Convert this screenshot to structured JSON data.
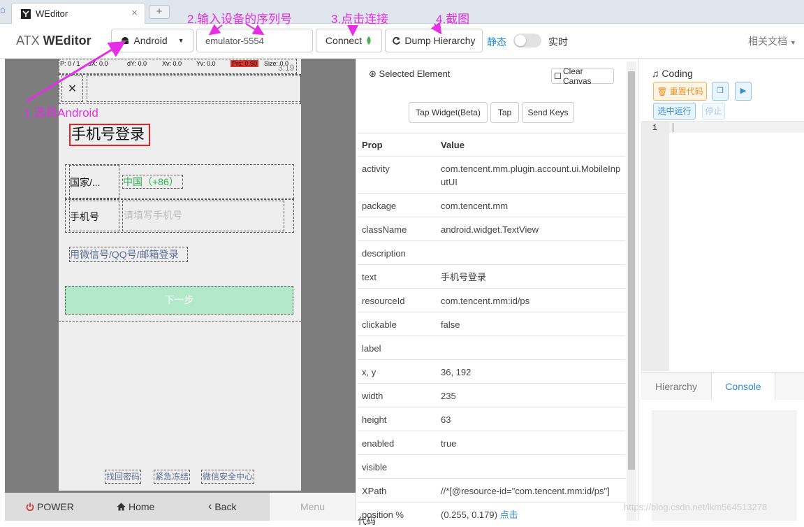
{
  "browser": {
    "home_icon": "home-icon",
    "tab_title": "WEditor",
    "tab_close": "×",
    "new_tab": "+"
  },
  "toolbar": {
    "brand_prefix": "ATX ",
    "brand_name": "WEditor",
    "platform_label": "Android",
    "serial_value": "emulator-5554",
    "connect_label": "Connect",
    "dump_label": "Dump Hierarchy",
    "static_label": "静态",
    "live_label": "实时",
    "live_toggle_on": false,
    "docs_label": "相关文档"
  },
  "annotations": {
    "step1": "1.选择Android",
    "step2": "2.输入设备的序列号",
    "step3": "3.点击连接",
    "step4": "4.截图",
    "color": "#e52ee5"
  },
  "device": {
    "status_items": [
      "P: 0 / 1",
      "dX: 0.0",
      "dY: 0.0",
      "Xv: 0.0",
      "Yv: 0.0",
      "Prs: 0.50",
      "Size: 0.0",
      "3:19"
    ],
    "close_glyph": "×",
    "page_title": "手机号登录",
    "country_label": "国家/...",
    "country_value": "中国（+86）",
    "phone_label": "手机号",
    "phone_placeholder": "请填写手机号",
    "alt_login": "用微信号/QQ号/邮箱登录",
    "next_button": "下一步",
    "footer_links": [
      "找回密码",
      "紧急冻结",
      "微信安全中心"
    ],
    "nav": {
      "power": "POWER",
      "home": "Home",
      "back": "Back",
      "menu": "Menu"
    }
  },
  "properties": {
    "header": "Selected Element",
    "clear_canvas": "Clear Canvas",
    "actions": [
      "Tap Widget(Beta)",
      "Tap",
      "Send Keys"
    ],
    "col_prop": "Prop",
    "col_value": "Value",
    "rows": [
      {
        "k": "activity",
        "v": "com.tencent.mm.plugin.account.ui.MobileInputUI"
      },
      {
        "k": "package",
        "v": "com.tencent.mm"
      },
      {
        "k": "className",
        "v": "android.widget.TextView"
      },
      {
        "k": "description",
        "v": ""
      },
      {
        "k": "text",
        "v": "手机号登录"
      },
      {
        "k": "resourceId",
        "v": "com.tencent.mm:id/ps"
      },
      {
        "k": "clickable",
        "v": "false"
      },
      {
        "k": "label",
        "v": ""
      },
      {
        "k": "x, y",
        "v": "36, 192"
      },
      {
        "k": "width",
        "v": "235"
      },
      {
        "k": "height",
        "v": "63"
      },
      {
        "k": "enabled",
        "v": "true"
      },
      {
        "k": "visible",
        "v": ""
      },
      {
        "k": "XPath",
        "v": "//*[@resource-id=\"com.tencent.mm:id/ps\"]"
      }
    ],
    "position_key": "position %",
    "position_value": "(0.255, 0.179)",
    "position_link": "点击",
    "cut_text": "代码"
  },
  "coding": {
    "title": "Coding",
    "reset_code": "重置代码",
    "run_selected": "选中运行",
    "stop": "停止",
    "line_number": "1",
    "tab_hierarchy": "Hierarchy",
    "tab_console": "Console"
  },
  "watermark": "https://blog.csdn.net/lkm564513278"
}
